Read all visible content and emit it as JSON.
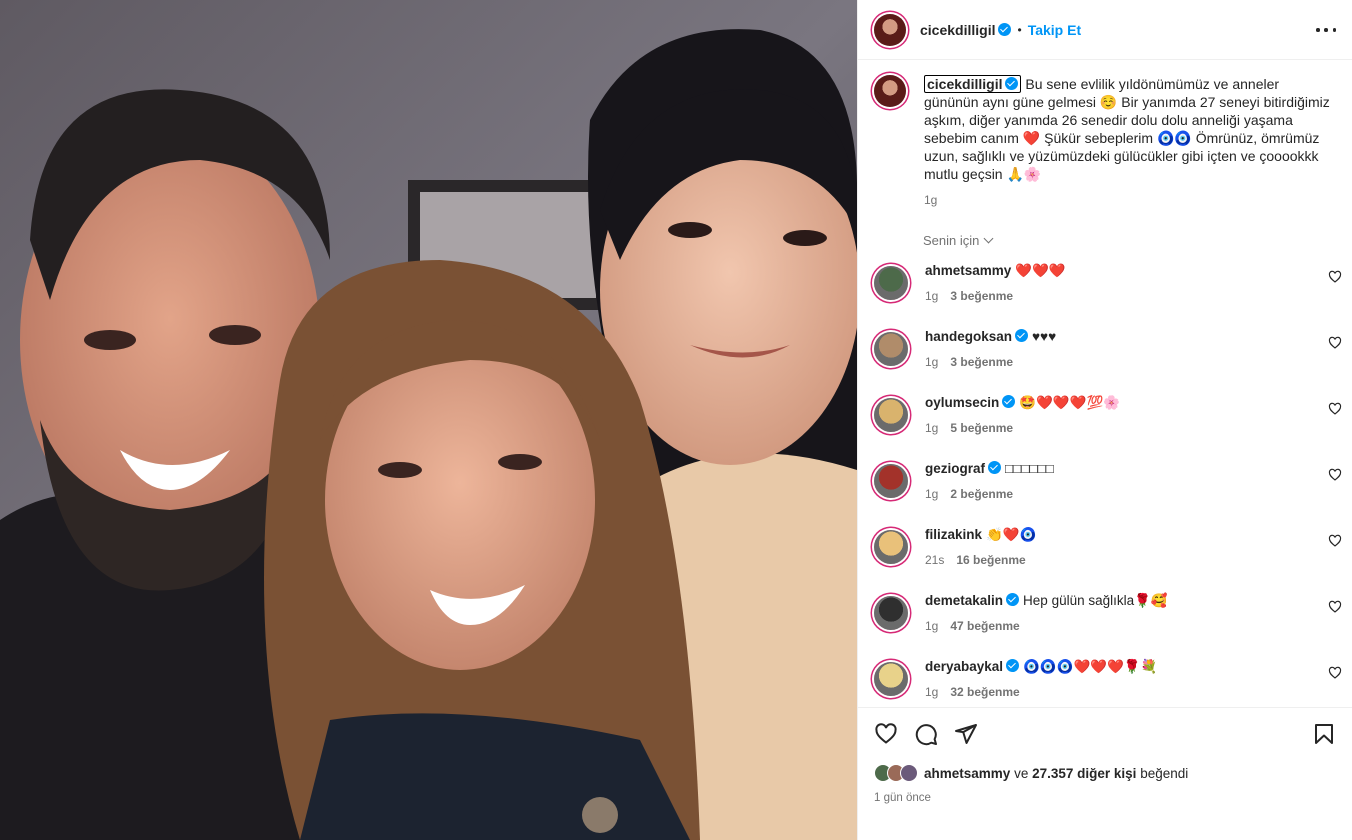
{
  "post": {
    "username": "cicekdilligil",
    "follow_label": "Takip Et",
    "dot": "•",
    "caption": "Bu sene evlilik yıldönümümüz ve anneler gününün aynı güne gelmesi ☺️ Bir yanımda 27 seneyi bitirdiğimiz aşkım, diğer yanımda 26 senedir dolu dolu anneliği yaşama sebebim canım ❤️ Şükür sebeplerim 🧿🧿 Ömrünüz, ömrümüz uzun, sağlıklı ve yüzümüzdeki gülücükler gibi içten ve çooookkk mutlu geçsin 🙏🌸",
    "caption_time": "1g",
    "for_you_label": "Senin için"
  },
  "comments": [
    {
      "user": "ahmetsammy",
      "verified": false,
      "text": "❤️❤️❤️",
      "time": "1g",
      "likes": "3 beğenme",
      "color": "#4d6a4a"
    },
    {
      "user": "handegoksan",
      "verified": true,
      "text": "♥♥♥",
      "time": "1g",
      "likes": "3 beğenme",
      "color": "#b08c6a"
    },
    {
      "user": "oylumsecin",
      "verified": true,
      "text": "🤩❤️❤️❤️💯🌸",
      "time": "1g",
      "likes": "5 beğenme",
      "color": "#d9b36d"
    },
    {
      "user": "geziograf",
      "verified": true,
      "text": "□□□□□□",
      "time": "1g",
      "likes": "2 beğenme",
      "color": "#a3322a"
    },
    {
      "user": "filizakink",
      "verified": false,
      "text": "👏❤️🧿",
      "time": "21s",
      "likes": "16 beğenme",
      "color": "#e9c17a"
    },
    {
      "user": "demetakalin",
      "verified": true,
      "text": "Hep gülün sağlıkla🌹🥰",
      "time": "1g",
      "likes": "47 beğenme",
      "color": "#2f2f2f"
    },
    {
      "user": "deryabaykal",
      "verified": true,
      "text": "🧿🧿🧿❤️❤️❤️🌹💐",
      "time": "1g",
      "likes": "32 beğenme",
      "color": "#e8d28a"
    }
  ],
  "likes_summary": {
    "user": "ahmetsammy",
    "middle": "ve",
    "count": "27.357 diğer kişi",
    "suffix": "beğendi"
  },
  "posted_ago": "1 gün önce",
  "icons": {
    "like": "heart-icon",
    "comment": "comment-icon",
    "share": "share-icon",
    "save": "bookmark-icon",
    "more": "more-options-icon"
  },
  "colors": {
    "accent": "#0095f6",
    "text": "#262626",
    "muted": "#737373",
    "ring": "#d62976"
  }
}
